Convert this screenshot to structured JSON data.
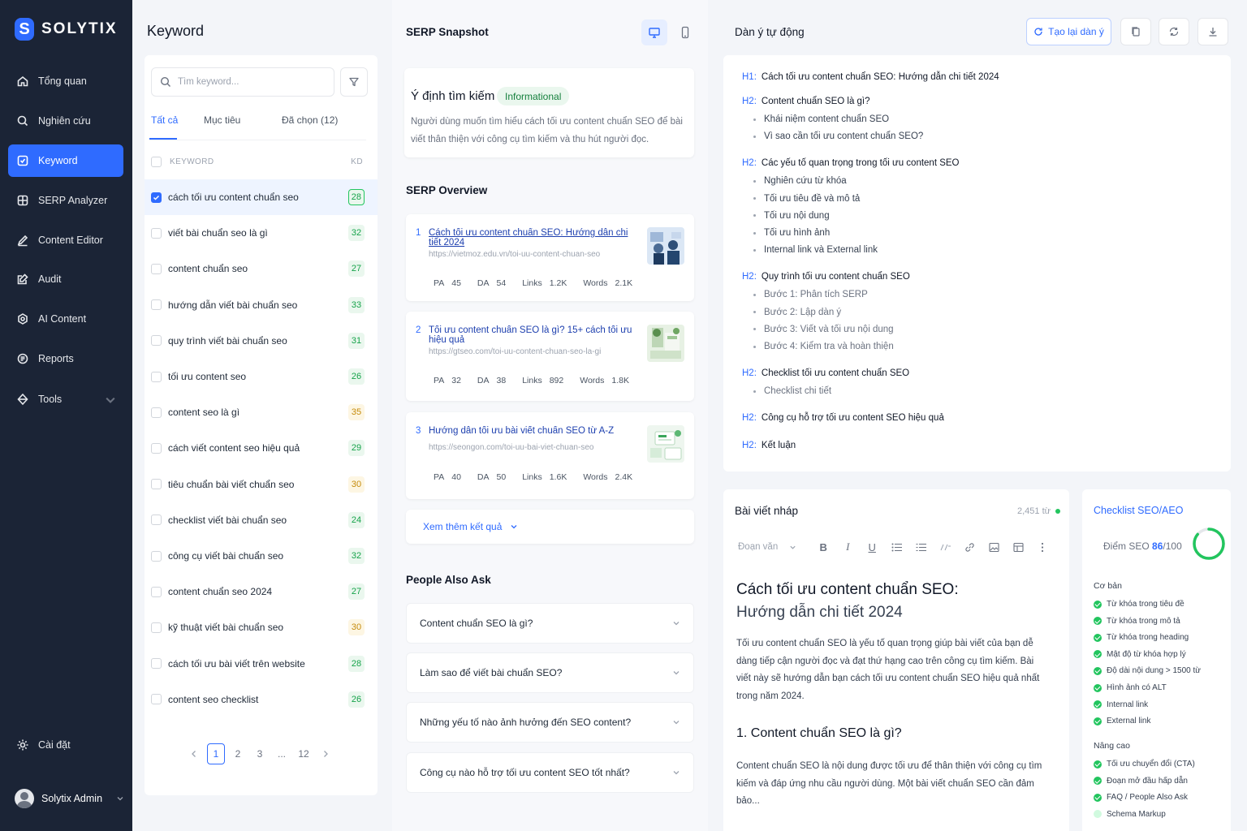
{
  "brand": {
    "logo_letter": "S",
    "name": "SOLYTIX"
  },
  "colors": {
    "sidebar": "#1b2436",
    "accent": "#2f6bff",
    "success": "#22c55e",
    "warning": "#c58b0b"
  },
  "sidebar": {
    "items": [
      {
        "label": "Tổng quan",
        "icon": "home-icon"
      },
      {
        "label": "Nghiên cứu",
        "icon": "search-icon"
      },
      {
        "label": "Keyword",
        "icon": "keyword-icon",
        "active": true
      },
      {
        "label": "SERP Analyzer",
        "icon": "grid-icon"
      },
      {
        "label": "Content Editor",
        "icon": "pen-icon"
      },
      {
        "label": "Audit",
        "icon": "edit-icon"
      },
      {
        "label": "AI Content",
        "icon": "ai-icon"
      },
      {
        "label": "Reports",
        "icon": "report-icon"
      },
      {
        "label": "Tools",
        "icon": "tools-icon",
        "has_chevron": true
      }
    ],
    "settings": "Cài đặt",
    "user": "Solytix Admin"
  },
  "keyword_panel": {
    "title": "Keyword",
    "search_placeholder": "Tìm keyword...",
    "tabs": [
      "Tất cả",
      "Mục tiêu",
      "Đã chọn (12)"
    ],
    "active_tab": 0,
    "col_keyword": "KEYWORD",
    "col_kd": "KD",
    "rows": [
      {
        "keyword": "cách tối ưu content chuẩn seo",
        "kd": "28",
        "checked": true,
        "level": "g"
      },
      {
        "keyword": "viết bài chuẩn seo là gì",
        "kd": "32",
        "level": "g"
      },
      {
        "keyword": "content chuẩn seo",
        "kd": "27",
        "level": "g"
      },
      {
        "keyword": "hướng dẫn viết bài chuẩn seo",
        "kd": "33",
        "level": "g"
      },
      {
        "keyword": "quy trình viết bài chuẩn seo",
        "kd": "31",
        "level": "g"
      },
      {
        "keyword": "tối ưu content seo",
        "kd": "26",
        "level": "g"
      },
      {
        "keyword": "content seo là gì",
        "kd": "35",
        "level": "y"
      },
      {
        "keyword": "cách viết content seo hiệu quả",
        "kd": "29",
        "level": "g"
      },
      {
        "keyword": "tiêu chuẩn bài viết chuẩn seo",
        "kd": "30",
        "level": "y"
      },
      {
        "keyword": "checklist viết bài chuẩn seo",
        "kd": "24",
        "level": "g"
      },
      {
        "keyword": "công cụ viết bài chuẩn seo",
        "kd": "32",
        "level": "g"
      },
      {
        "keyword": "content chuẩn seo 2024",
        "kd": "27",
        "level": "g"
      },
      {
        "keyword": "kỹ thuật viết bài chuẩn seo",
        "kd": "30",
        "level": "y"
      },
      {
        "keyword": "cách tối ưu bài viết trên website",
        "kd": "28",
        "level": "g"
      },
      {
        "keyword": "content seo checklist",
        "kd": "26",
        "level": "g"
      }
    ],
    "pagination": {
      "pages": [
        "1",
        "2",
        "3",
        "...",
        "12"
      ],
      "current": "1"
    }
  },
  "serp": {
    "title": "SERP Snapshot",
    "intent": {
      "title": "Ý định tìm kiếm",
      "badge": "Informational",
      "desc": "Người dùng muốn tìm hiểu cách tối ưu content chuẩn SEO để bài viết thân thiện với công cụ tìm kiếm và thu hút người đọc."
    },
    "overview_title": "SERP Overview",
    "results": [
      {
        "num": "1",
        "title": "Cách tối ưu content chuẩn SEO: Hướng dẫn chi tiết 2024",
        "url": "https://vietmoz.edu.vn/toi-uu-content-chuan-seo",
        "pa": "45",
        "da": "54",
        "links": "1.2K",
        "words": "2.1K"
      },
      {
        "num": "2",
        "title": "Tối ưu content chuẩn SEO là gì? 15+ cách tối ưu hiệu quả",
        "url": "https://gtseo.com/toi-uu-content-chuan-seo-la-gi",
        "pa": "32",
        "da": "38",
        "links": "892",
        "words": "1.8K"
      },
      {
        "num": "3",
        "title": "Hướng dẫn tối ưu bài viết chuẩn SEO từ A-Z",
        "url": "https://seongon.com/toi-uu-bai-viet-chuan-seo",
        "pa": "40",
        "da": "50",
        "links": "1.6K",
        "words": "2.4K"
      }
    ],
    "metric_labels": {
      "pa": "PA",
      "da": "DA",
      "links": "Links",
      "words": "Words"
    },
    "more_label": "Xem thêm kết quả",
    "paa_title": "People Also Ask",
    "paa": [
      "Content chuẩn SEO là gì?",
      "Làm sao để viết bài chuẩn SEO?",
      "Những yếu tố nào ảnh hưởng đến SEO content?",
      "Công cụ nào hỗ trợ tối ưu content SEO tốt nhất?"
    ]
  },
  "outline": {
    "title": "Dàn ý tự động",
    "regen_label": "Tạo lại dàn ý",
    "items": [
      {
        "tag": "H1:",
        "text": "Cách tối ưu content chuẩn SEO: Hướng dẫn chi tiết 2024"
      },
      {
        "tag": "H2:",
        "text": "Content chuẩn SEO là gì?",
        "children": [
          "Khái niệm content chuẩn SEO",
          "Vì sao cần tối ưu content chuẩn SEO?"
        ]
      },
      {
        "tag": "H2:",
        "text": "Các yếu tố quan trọng trong tối ưu content SEO",
        "children": [
          "Nghiên cứu từ khóa",
          "Tối ưu tiêu đề và mô tả",
          "Tối ưu nội dung",
          "Tối ưu hình ảnh",
          "Internal link và External link"
        ]
      },
      {
        "tag": "H2:",
        "text": "Quy trình tối ưu content chuẩn SEO",
        "children": [
          "Bước 1: Phân tích SERP",
          "Bước 2: Lập dàn ý",
          "Bước 3: Viết và tối ưu nội dung",
          "Bước 4: Kiểm tra và hoàn thiện"
        ]
      },
      {
        "tag": "H2:",
        "text": "Checklist tối ưu content chuẩn SEO",
        "children": [
          "Checklist chi tiết"
        ]
      },
      {
        "tag": "H2:",
        "text": "Công cụ hỗ trợ tối ưu content SEO hiệu quả"
      },
      {
        "tag": "H2:",
        "text": "Kết luận"
      }
    ]
  },
  "draft": {
    "title": "Bài viết nháp",
    "word_count": "2,451 từ",
    "paragraph_select": "Đoạn văn",
    "h1_line1": "Cách tối ưu content chuẩn SEO:",
    "h1_line2": "Hướng dẫn chi tiết 2024",
    "intro": "Tối ưu content chuẩn SEO là yếu tố quan trọng giúp bài viết của bạn dễ dàng tiếp cận người đọc và đạt thứ hạng cao trên công cụ tìm kiếm. Bài viết này sẽ hướng dẫn bạn cách tối ưu content chuẩn SEO hiệu quả nhất trong năm 2024.",
    "h2": "1. Content chuẩn SEO là gì?",
    "body": "Content chuẩn SEO là nội dung được tối ưu để thân thiện với công cụ tìm kiếm và đáp ứng nhu cầu người dùng. Một bài viết chuẩn SEO cần đảm bảo..."
  },
  "checklist": {
    "title": "Checklist SEO/AEO",
    "score_label": "Điểm SEO",
    "score": 86,
    "score_display": "86",
    "score_max": "/100",
    "basic_title": "Cơ bản",
    "basic": [
      "Từ khóa trong tiêu đề",
      "Từ khóa trong mô tả",
      "Từ khóa trong heading",
      "Mật độ từ khóa hợp lý",
      "Độ dài nội dung > 1500 từ",
      "Hình ảnh có ALT",
      "Internal link",
      "External link"
    ],
    "advanced_title": "Nâng cao",
    "advanced": [
      {
        "label": "Tối ưu chuyển đổi (CTA)",
        "done": true
      },
      {
        "label": "Đoạn mở đầu hấp dẫn",
        "done": true
      },
      {
        "label": "FAQ / People Also Ask",
        "done": true
      },
      {
        "label": "Schema Markup",
        "done": false
      }
    ]
  }
}
